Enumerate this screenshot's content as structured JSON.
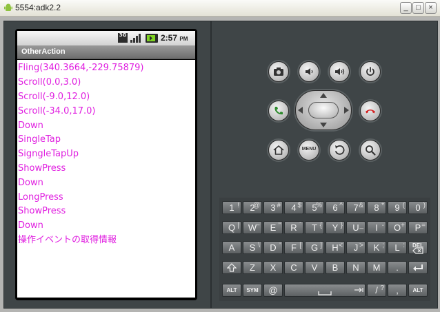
{
  "window": {
    "title": "5554:adk2.2",
    "buttons": {
      "minimize": "_",
      "maximize": "□",
      "close": "×"
    }
  },
  "status_bar": {
    "network": "3G",
    "time": "2:57",
    "ampm": "PM",
    "icons": [
      "network-3g-icon",
      "signal-icon",
      "battery-icon"
    ]
  },
  "app": {
    "title": "OtherAction",
    "text_color": "#e020e0",
    "log_lines": [
      "Fling(340.3664,-229.75879)",
      "Scroll(0.0,3.0)",
      "Scroll(-9.0,12.0)",
      "Scroll(-34.0,17.0)",
      "Down",
      "SingleTap",
      "SigngleTapUp",
      "ShowPress",
      "Down",
      "LongPress",
      "ShowPress",
      "Down",
      "操作イベントの取得情報"
    ]
  },
  "hardware": {
    "top_row": [
      "camera-icon",
      "volume-down-icon",
      "volume-up-icon",
      "power-icon"
    ],
    "call_button": "call-icon",
    "end_call_button": "end-call-icon",
    "bottom_row": [
      "home-icon",
      "menu",
      "back-icon",
      "search-icon"
    ],
    "menu_label": "MENU"
  },
  "keyboard": {
    "row1": [
      {
        "main": "1",
        "alt": "!"
      },
      {
        "main": "2",
        "alt": "@"
      },
      {
        "main": "3",
        "alt": "#"
      },
      {
        "main": "4",
        "alt": "$"
      },
      {
        "main": "5",
        "alt": "%"
      },
      {
        "main": "6",
        "alt": "^"
      },
      {
        "main": "7",
        "alt": "&"
      },
      {
        "main": "8",
        "alt": "*"
      },
      {
        "main": "9",
        "alt": "("
      },
      {
        "main": "0",
        "alt": ")"
      }
    ],
    "row2": [
      {
        "main": "Q",
        "alt": "|"
      },
      {
        "main": "W",
        "alt": "~"
      },
      {
        "main": "E",
        "alt": "\""
      },
      {
        "main": "R",
        "alt": "`"
      },
      {
        "main": "T",
        "alt": "{"
      },
      {
        "main": "Y",
        "alt": "}"
      },
      {
        "main": "U",
        "alt": "_"
      },
      {
        "main": "I",
        "alt": "-"
      },
      {
        "main": "O",
        "alt": "+"
      },
      {
        "main": "P",
        "alt": "="
      }
    ],
    "row3": [
      {
        "main": "A",
        "alt": ""
      },
      {
        "main": "S",
        "alt": "\\"
      },
      {
        "main": "D",
        "alt": "'"
      },
      {
        "main": "F",
        "alt": "["
      },
      {
        "main": "G",
        "alt": "]"
      },
      {
        "main": "H",
        "alt": "<"
      },
      {
        "main": "J",
        "alt": ">"
      },
      {
        "main": "K",
        "alt": ";"
      },
      {
        "main": "L",
        "alt": ":"
      }
    ],
    "del_label": "DEL",
    "row4": [
      {
        "main": "Z",
        "alt": ""
      },
      {
        "main": "X",
        "alt": ""
      },
      {
        "main": "C",
        "alt": ""
      },
      {
        "main": "V",
        "alt": ""
      },
      {
        "main": "B",
        "alt": ""
      },
      {
        "main": "N",
        "alt": ""
      },
      {
        "main": "M",
        "alt": ""
      },
      {
        "main": ".",
        "alt": ""
      }
    ],
    "row5": {
      "alt_left": "ALT",
      "sym": "SYM",
      "at": "@",
      "slash": "/",
      "question": "?",
      "comma": ",",
      "alt_right": "ALT"
    }
  }
}
